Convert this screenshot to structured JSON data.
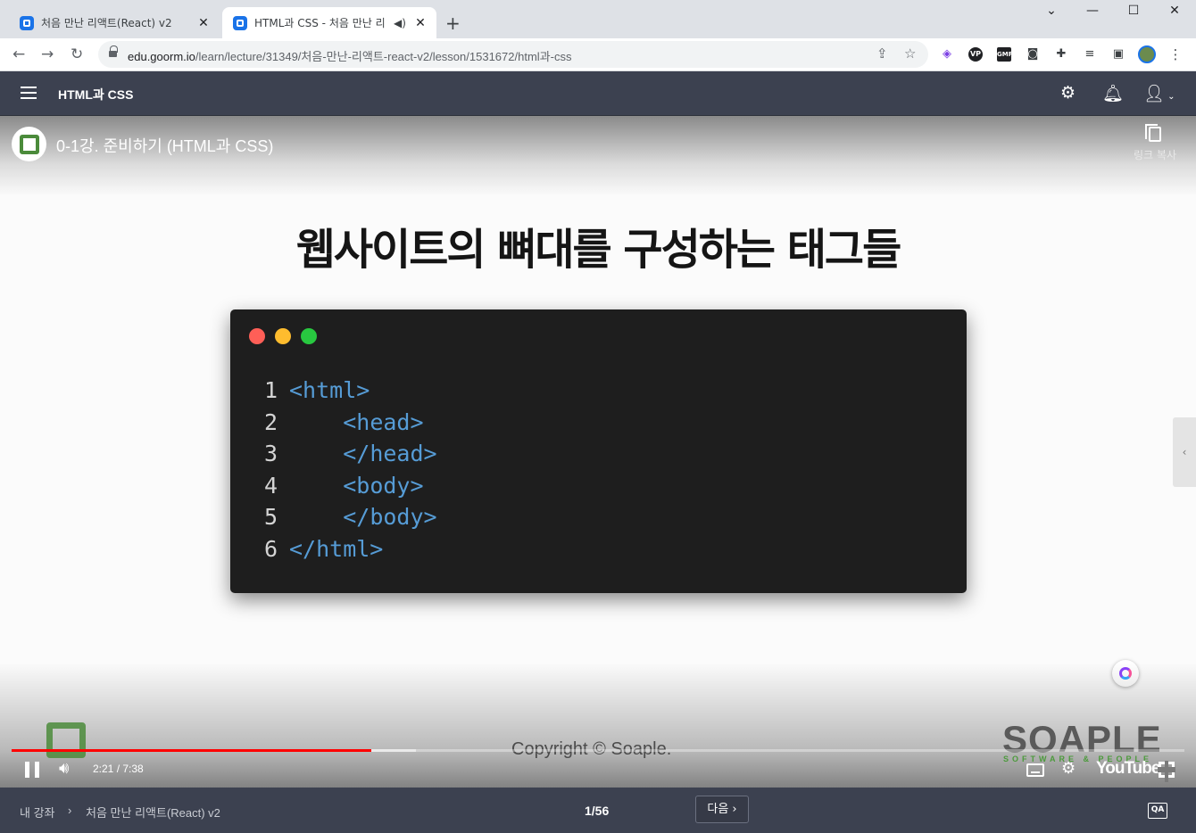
{
  "browser": {
    "tabs": [
      {
        "title": "처음 만난 리액트(React) v2",
        "active": false
      },
      {
        "title": "HTML과 CSS - 처음 만난 리",
        "active": true,
        "audio": true
      }
    ],
    "new_tab": "+",
    "window_controls": {
      "minimize": "—",
      "maximize": "☐",
      "close": "✕",
      "dropdown": "⌄"
    },
    "url_host": "edu.goorm.io",
    "url_path": "/learn/lecture/31349/처음-만난-리액트-react-v2/lesson/1531672/html과-css",
    "extensions": [
      "share-icon",
      "star-icon",
      "clickup-ext-icon",
      "vpn-ext-icon",
      "gmp-ext-icon",
      "camera-icon",
      "puzzle-icon",
      "media-icon",
      "sidepanel-icon",
      "profile-avatar",
      "kebab-menu-icon"
    ],
    "ext_labels": {
      "gmp": "GMP",
      "vpn": "VP"
    }
  },
  "header": {
    "title": "HTML과 CSS"
  },
  "video": {
    "title": "0-1강. 준비하기 (HTML과 CSS)",
    "copy_link_label": "링크 복사",
    "slide_heading": "웹사이트의 뼈대를 구성하는 태그들",
    "code_lines": [
      {
        "n": "1",
        "indent": "",
        "text": "<html>"
      },
      {
        "n": "2",
        "indent": "    ",
        "text": "<head>"
      },
      {
        "n": "3",
        "indent": "    ",
        "text": "</head>"
      },
      {
        "n": "4",
        "indent": "    ",
        "text": "<body>"
      },
      {
        "n": "5",
        "indent": "    ",
        "text": "</body>"
      },
      {
        "n": "6",
        "indent": "",
        "text": "</html>"
      }
    ],
    "window_dot_colors": [
      "#ff5f57",
      "#febc2e",
      "#28c840"
    ],
    "copyright": "Copyright © Soaple.",
    "brand": "SOAPLE",
    "brand_sub": "SOFTWARE & PEOPLE",
    "time": "2:21 / 7:38",
    "played_fraction": 0.307,
    "loaded_fraction": 0.345,
    "youtube_label": "YouTube",
    "accent": "#ff0000"
  },
  "footer": {
    "breadcrumb_root": "내 강좌",
    "breadcrumb_sep": "›",
    "breadcrumb_course": "처음 만난 리액트(React) v2",
    "page": "1/56",
    "next_label": "다음 ›",
    "qa_label": "QA"
  },
  "colors": {
    "header_bg": "#3c4150",
    "tag_blue": "#569cd6",
    "code_bg": "#1e1e1e"
  }
}
